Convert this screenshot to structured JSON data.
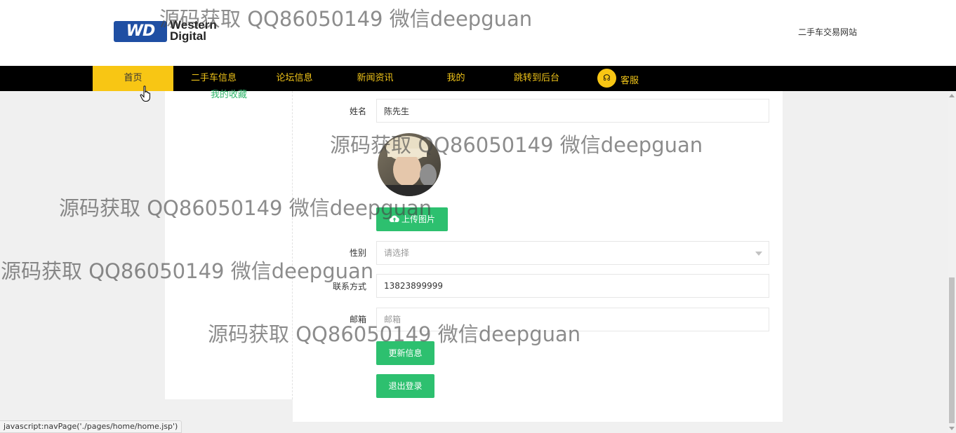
{
  "header": {
    "logo_badge": "WD",
    "logo_word1": "Western",
    "logo_word2": "Digital",
    "site_name": "二手车交易网站"
  },
  "nav": {
    "items": [
      {
        "label": "首页",
        "active": true
      },
      {
        "label": "二手车信息"
      },
      {
        "label": "论坛信息"
      },
      {
        "label": "新闻资讯"
      },
      {
        "label": "我的"
      },
      {
        "label": "跳转到后台"
      },
      {
        "label": "客服"
      }
    ],
    "kefu_icon": "headset-icon"
  },
  "sidebar": {
    "link_label": "我的收藏"
  },
  "form": {
    "name_label": "姓名",
    "name_value": "陈先生",
    "upload_label": "上传图片",
    "gender_label": "性别",
    "gender_placeholder": "请选择",
    "phone_label": "联系方式",
    "phone_value": "13823899999",
    "email_label": "邮箱",
    "email_placeholder": "邮箱",
    "update_label": "更新信息",
    "logout_label": "退出登录"
  },
  "watermark_text": "源码获取 QQ86050149 微信deepguan",
  "status_url": "javascript:navPage('./pages/home/home.jsp')",
  "colors": {
    "nav_bg": "#000000",
    "nav_active": "#f8c614",
    "nav_text": "#f0c419",
    "accent_green": "#2dc06f",
    "logo_blue": "#1f4fa3"
  }
}
